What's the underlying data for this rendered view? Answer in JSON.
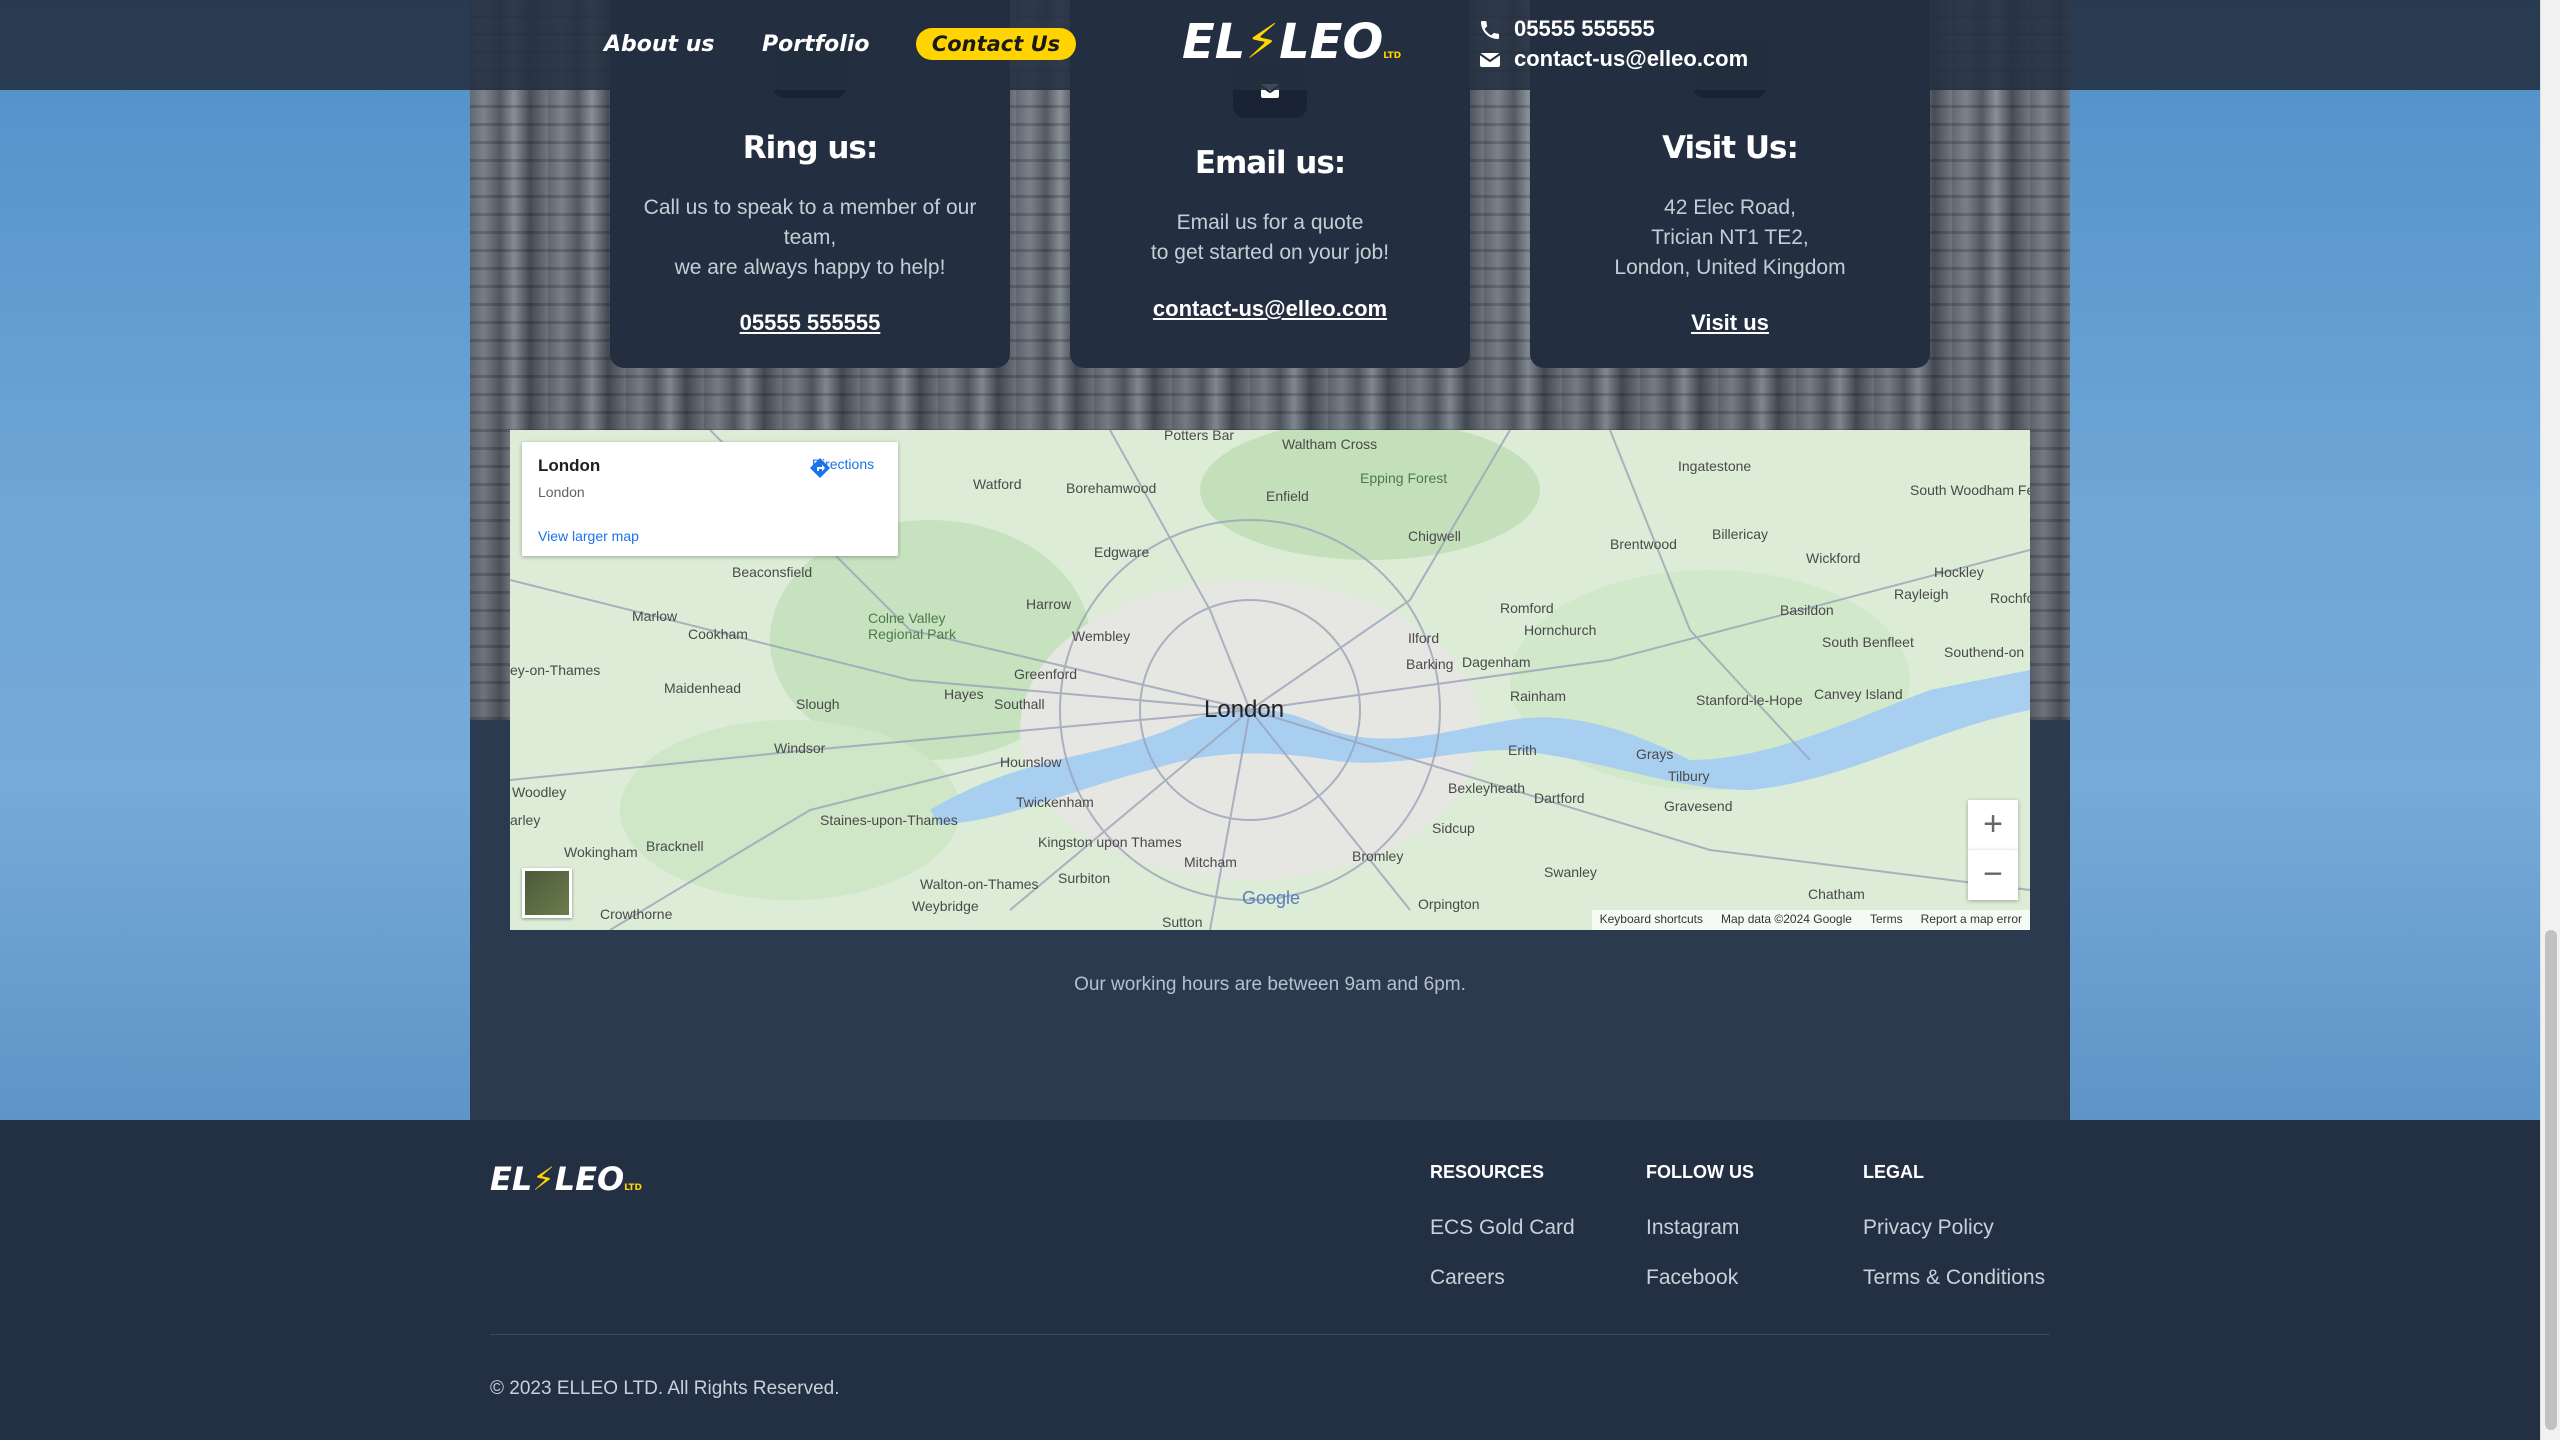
{
  "header": {
    "nav": {
      "about": "About us",
      "portfolio": "Portfolio",
      "contact": "Contact Us"
    },
    "logo": {
      "part1": "EL",
      "part2": "LEO",
      "ltd": "LTD"
    },
    "phone": "05555 555555",
    "email": "contact-us@elleo.com",
    "icons": {
      "phone": "phone-icon",
      "email": "envelope-icon"
    }
  },
  "cards": [
    {
      "title": "Ring us:",
      "text1": "Call us to speak to a member of our",
      "text2": "team,",
      "text3": "we are always happy to help!",
      "link": "05555 555555",
      "icon": "phone-icon"
    },
    {
      "title": "Email us:",
      "text1": "Email us for a quote",
      "text2": "to get started on your job!",
      "link": "contact-us@elleo.com",
      "icon": "envelope-icon"
    },
    {
      "title": "Visit Us:",
      "text1": "42 Elec Road,",
      "text2": "Trician NT1 TE2,",
      "text3": "London, United Kingdom",
      "link": "Visit us",
      "icon": "location-icon"
    }
  ],
  "map": {
    "info_title": "London",
    "info_subtitle": "London",
    "directions": "Directions",
    "larger_map": "View larger map",
    "center_label": "London",
    "places": [
      "Watford",
      "Borehamwood",
      "Enfield",
      "Epping Forest",
      "Potters Bar",
      "Waltham Cross",
      "Ingatestone",
      "South Woodham Ferrers",
      "Chigwell",
      "Brentwood",
      "Billericay",
      "Wickford",
      "Hockley",
      "Rayleigh",
      "Beaconsfield",
      "Edgware",
      "Romford",
      "Hornchurch",
      "Basildon",
      "Marlow",
      "Cookham",
      "Harrow",
      "Wembley",
      "Ilford",
      "Barking",
      "Dagenham",
      "South Benfleet",
      "Southend-on",
      "Maidenhead",
      "Slough",
      "Hayes",
      "Greenford",
      "Southall",
      "Rainham",
      "Stanford-le-Hope",
      "Canvey Island",
      "Windsor",
      "Hounslow",
      "Erith",
      "Grays",
      "Tilbury",
      "Woodley",
      "Twickenham",
      "Bexleyheath",
      "Dartford",
      "Gravesend",
      "Wokingham",
      "Bracknell",
      "Staines-upon-Thames",
      "Kingston upon Thames",
      "Mitcham",
      "Sidcup",
      "Surbiton",
      "Bromley",
      "Swanley",
      "Walton-on-Thames",
      "Weybridge",
      "Chatham",
      "Crowthorne",
      "Sutton",
      "Orpington",
      "Colne Valley Regional Park",
      "ey-on-Thames",
      "arley",
      "Rochfo"
    ],
    "footer": {
      "shortcuts": "Keyboard shortcuts",
      "data": "Map data ©2024 Google",
      "terms": "Terms",
      "report": "Report a map error"
    },
    "zoom_in": "+",
    "zoom_out": "−",
    "google": "Google"
  },
  "hours": "Our working hours are between 9am and 6pm.",
  "footer": {
    "logo": {
      "part1": "EL",
      "part2": "LEO",
      "ltd": "LTD"
    },
    "columns": [
      {
        "heading": "RESOURCES",
        "links": [
          "ECS Gold Card",
          "Careers"
        ]
      },
      {
        "heading": "FOLLOW US",
        "links": [
          "Instagram",
          "Facebook"
        ]
      },
      {
        "heading": "LEGAL",
        "links": [
          "Privacy Policy",
          "Terms & Conditions"
        ]
      }
    ],
    "copyright": "© 2023 ELLEO LTD. All Rights Reserved."
  },
  "colors": {
    "accent": "#ffd400",
    "panel": "#2b3a4f",
    "card": "#232f40",
    "footer": "#233044"
  }
}
